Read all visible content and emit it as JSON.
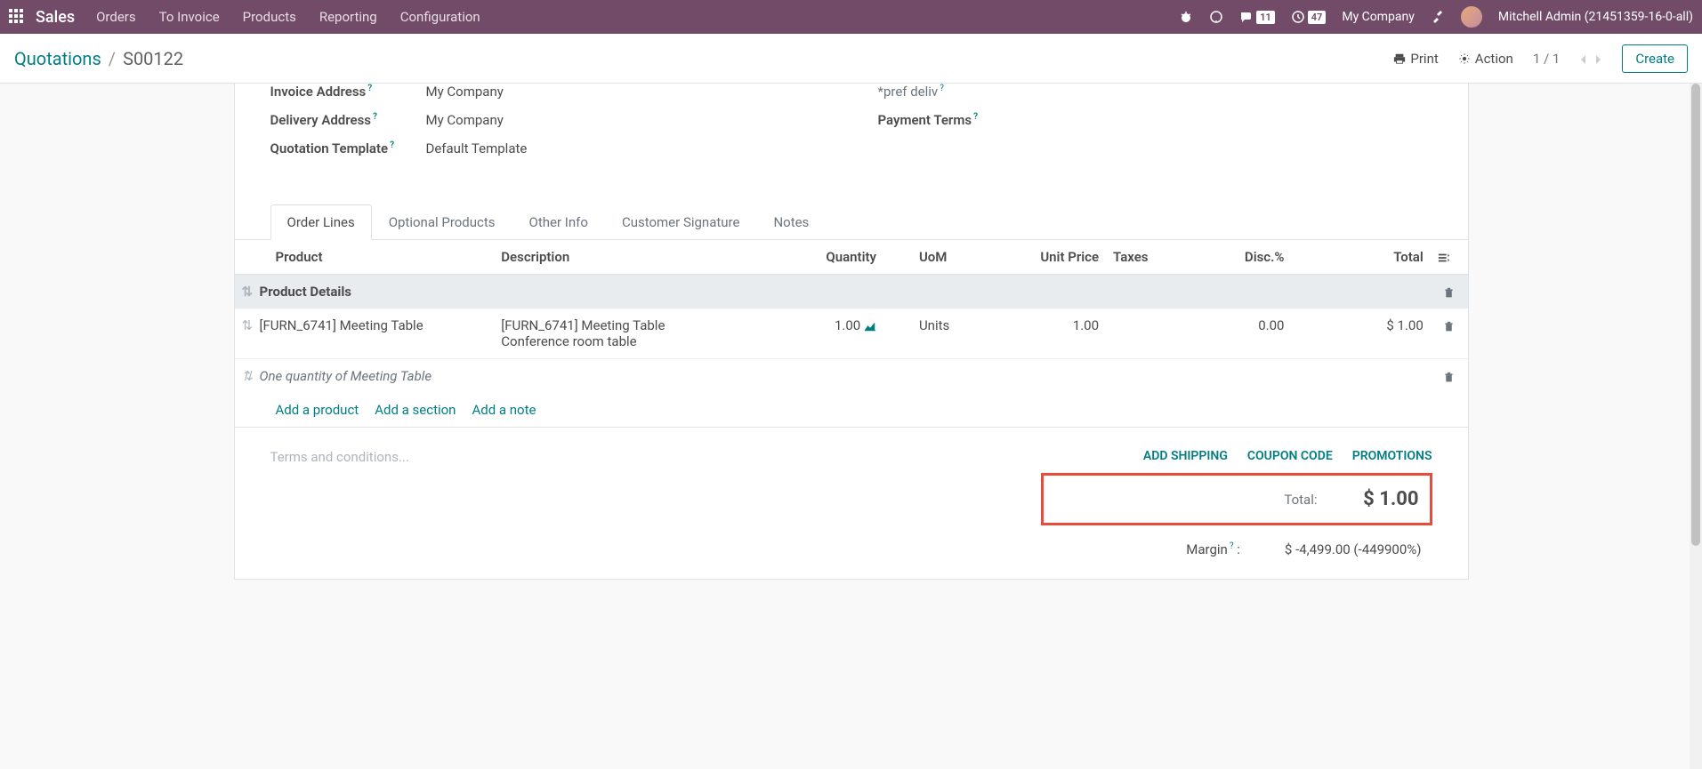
{
  "nav": {
    "brand": "Sales",
    "menu": [
      "Orders",
      "To Invoice",
      "Products",
      "Reporting",
      "Configuration"
    ],
    "msg_count": "11",
    "activity_count": "47",
    "company": "My Company",
    "user": "Mitchell Admin (21451359-16-0-all)"
  },
  "breadcrumb": {
    "root": "Quotations",
    "current": "S00122"
  },
  "actions": {
    "print": "Print",
    "action": "Action",
    "pager": "1 / 1",
    "create": "Create"
  },
  "form": {
    "invoice_addr_label": "Invoice Address",
    "invoice_addr_value": "My Company",
    "delivery_addr_label": "Delivery Address",
    "delivery_addr_value": "My Company",
    "template_label": "Quotation Template",
    "template_value": "Default Template",
    "pref_deliv_label": "*pref deliv",
    "payment_terms_label": "Payment Terms"
  },
  "tabs": [
    "Order Lines",
    "Optional Products",
    "Other Info",
    "Customer Signature",
    "Notes"
  ],
  "table": {
    "headers": {
      "product": "Product",
      "description": "Description",
      "qty": "Quantity",
      "uom": "UoM",
      "unit_price": "Unit Price",
      "taxes": "Taxes",
      "disc": "Disc.%",
      "total": "Total"
    },
    "section": "Product Details",
    "line": {
      "product": "[FURN_6741] Meeting Table",
      "desc1": "[FURN_6741] Meeting Table",
      "desc2": "Conference room table",
      "qty": "1.00",
      "uom": "Units",
      "unit_price": "1.00",
      "disc": "0.00",
      "total": "$ 1.00"
    },
    "note": "One quantity of Meeting Table"
  },
  "add": {
    "product": "Add a product",
    "section": "Add a section",
    "note": "Add a note"
  },
  "footer": {
    "terms_placeholder": "Terms and conditions...",
    "shipping": "ADD SHIPPING",
    "coupon": "COUPON CODE",
    "promotions": "PROMOTIONS",
    "total_label": "Total:",
    "total_value": "$ 1.00",
    "margin_label": "Margin",
    "margin_value": "$ -4,499.00 (-449900%)"
  }
}
